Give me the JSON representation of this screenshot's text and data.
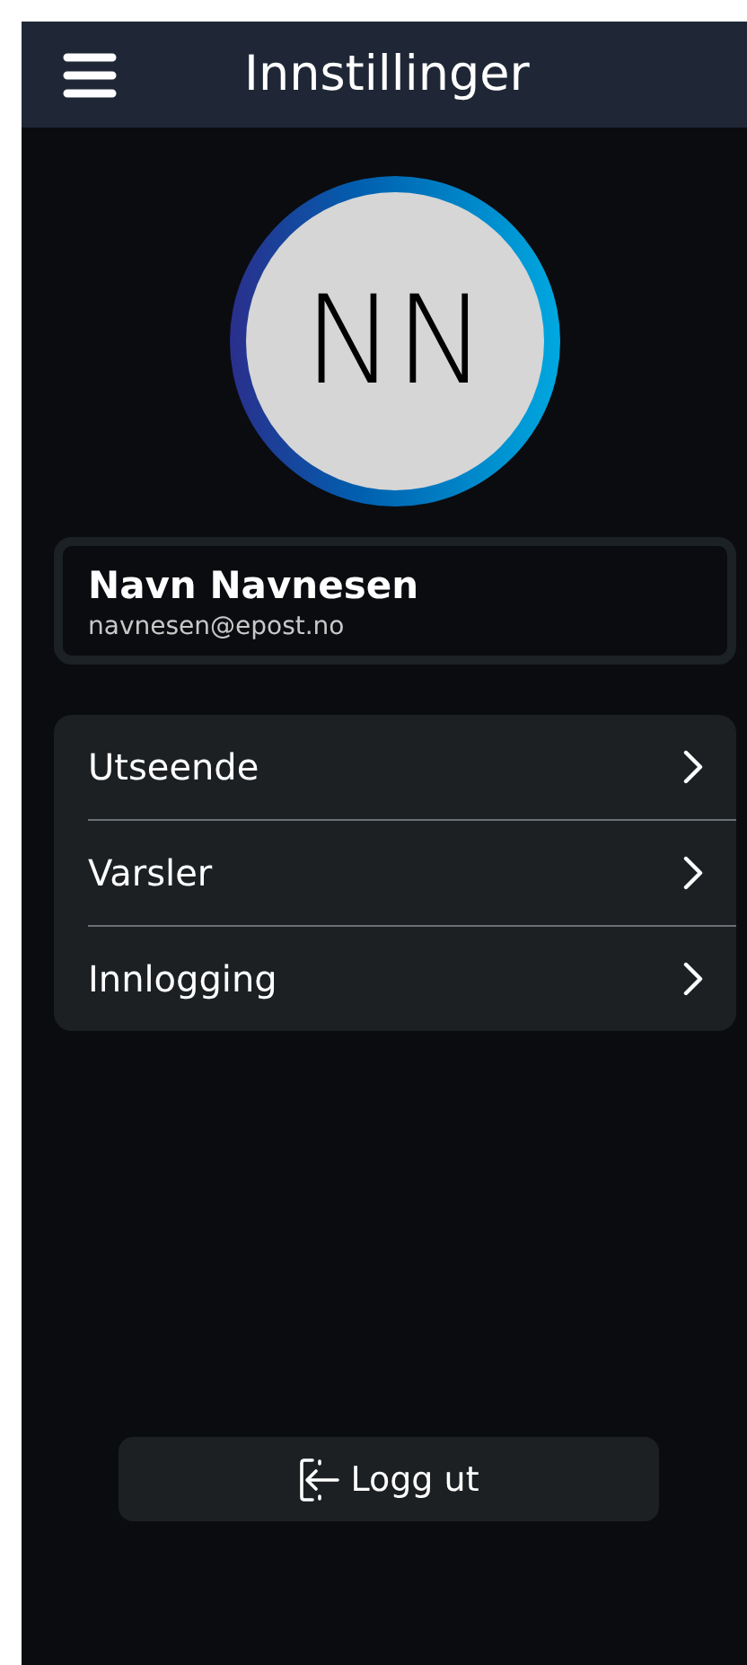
{
  "header": {
    "title": "Innstillinger"
  },
  "avatar": {
    "initials": "NN"
  },
  "profile": {
    "name": "Navn Navnesen",
    "email": "navnesen@epost.no"
  },
  "menu": [
    {
      "label": "Utseende"
    },
    {
      "label": "Varsler"
    },
    {
      "label": "Innlogging"
    }
  ],
  "logout": {
    "label": "Logg ut"
  }
}
